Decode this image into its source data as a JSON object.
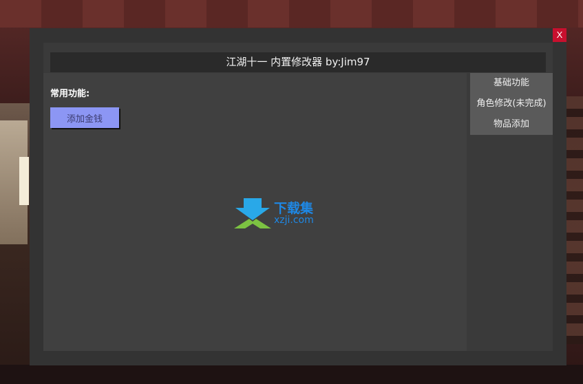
{
  "window": {
    "title": "江湖十一 内置修改器 by:Jim97",
    "close_label": "X"
  },
  "main": {
    "section_label": "常用功能:",
    "buttons": [
      {
        "label": "添加金钱"
      }
    ]
  },
  "sidebar": {
    "items": [
      {
        "label": "基础功能"
      },
      {
        "label": "角色修改(未完成)"
      },
      {
        "label": "物品添加"
      }
    ]
  },
  "watermark": {
    "text_cn": "下载集",
    "text_en": "xzji.com"
  },
  "colors": {
    "close": "#c8102e",
    "button": "#8c96f4",
    "watermark": "#1e88e5"
  }
}
